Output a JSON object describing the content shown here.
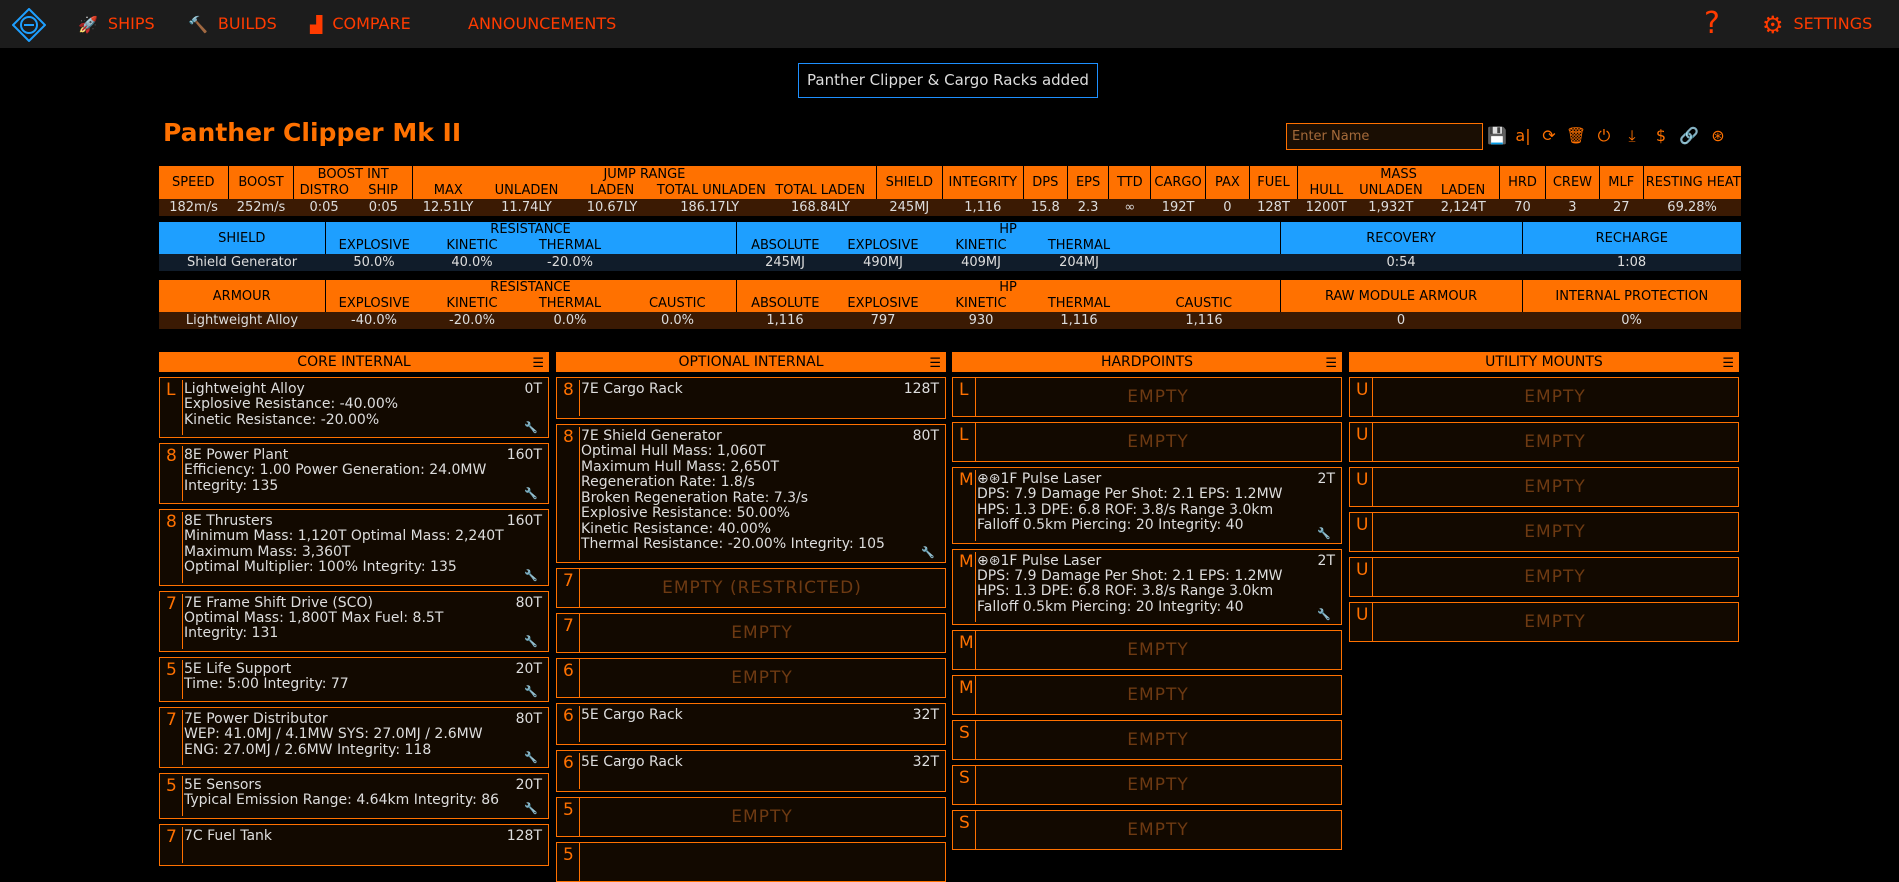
{
  "nav": {
    "ships": "SHIPS",
    "builds": "BUILDS",
    "compare": "COMPARE",
    "announcements": "ANNOUNCEMENTS",
    "help": "?",
    "settings": "SETTINGS"
  },
  "notice": "Panther Clipper & Cargo Racks added",
  "ship_title": "Panther Clipper Mk II",
  "name_placeholder": "Enter Name",
  "stats": {
    "speed": "SPEED",
    "boost": "BOOST",
    "boost_int": "BOOST INT",
    "distro": "DISTRO",
    "ship": "SHIP",
    "jump_range": "JUMP RANGE",
    "max": "MAX",
    "unladen": "UNLADEN",
    "laden": "LADEN",
    "total_unladen": "TOTAL UNLADEN",
    "total_laden": "TOTAL LADEN",
    "shield": "SHIELD",
    "integrity": "INTEGRITY",
    "dps": "DPS",
    "eps": "EPS",
    "ttd": "TTD",
    "cargo": "CARGO",
    "pax": "PAX",
    "fuel": "FUEL",
    "mass": "MASS",
    "hull": "HULL",
    "m_unladen": "UNLADEN",
    "m_laden": "LADEN",
    "hrd": "HRD",
    "crew": "CREW",
    "mlf": "MLF",
    "resting_heat": "RESTING HEAT (BETA)",
    "v_speed": "182m/s",
    "v_boost": "252m/s",
    "v_distro": "0:05",
    "v_ship": "0:05",
    "v_max": "12.51LY",
    "v_unladen": "11.74LY",
    "v_laden": "10.67LY",
    "v_total_unladen": "186.17LY",
    "v_total_laden": "168.84LY",
    "v_shield": "245MJ",
    "v_integrity": "1,116",
    "v_dps": "15.8",
    "v_eps": "2.3",
    "v_ttd": "∞",
    "v_cargo": "192T",
    "v_pax": "0",
    "v_fuel": "128T",
    "v_hull": "1200T",
    "v_m_unladen": "1,932T",
    "v_m_laden": "2,124T",
    "v_hrd": "70",
    "v_crew": "3",
    "v_mlf": "27",
    "v_heat": "69.28%"
  },
  "shield_table": {
    "shield": "SHIELD",
    "resistance": "RESISTANCE",
    "explosive": "EXPLOSIVE",
    "kinetic": "KINETIC",
    "thermal": "THERMAL",
    "hp": "HP",
    "absolute": "ABSOLUTE",
    "hp_explosive": "EXPLOSIVE",
    "hp_kinetic": "KINETIC",
    "hp_thermal": "THERMAL",
    "recovery": "RECOVERY",
    "recharge": "RECHARGE",
    "name": "Shield Generator",
    "r_exp": "50.0%",
    "r_kin": "40.0%",
    "r_therm": "-20.0%",
    "h_abs": "245MJ",
    "h_exp": "490MJ",
    "h_kin": "409MJ",
    "h_therm": "204MJ",
    "v_recovery": "0:54",
    "v_recharge": "1:08"
  },
  "armour_table": {
    "armour": "ARMOUR",
    "resistance": "RESISTANCE",
    "explosive": "EXPLOSIVE",
    "kinetic": "KINETIC",
    "thermal": "THERMAL",
    "caustic": "CAUSTIC",
    "hp": "HP",
    "absolute": "ABSOLUTE",
    "hp_explosive": "EXPLOSIVE",
    "hp_kinetic": "KINETIC",
    "hp_thermal": "THERMAL",
    "hp_caustic": "CAUSTIC",
    "raw": "RAW MODULE ARMOUR",
    "internal": "INTERNAL PROTECTION",
    "name": "Lightweight Alloy",
    "r_exp": "-40.0%",
    "r_kin": "-20.0%",
    "r_therm": "0.0%",
    "r_caus": "0.0%",
    "h_abs": "1,116",
    "h_exp": "797",
    "h_kin": "930",
    "h_therm": "1,116",
    "h_caus": "1,116",
    "v_raw": "0",
    "v_internal": "0%"
  },
  "core": {
    "header": "CORE INTERNAL",
    "slots": [
      {
        "cls": "L",
        "name": "Lightweight Alloy",
        "mass": "0T",
        "lines": [
          "Explosive Resistance: -40.00%",
          "Kinetic Resistance: -20.00%"
        ]
      },
      {
        "cls": "8",
        "name": "8E Power Plant",
        "mass": "160T",
        "lines": [
          "Efficiency: 1.00   Power Generation: 24.0MW",
          "Integrity: 135"
        ]
      },
      {
        "cls": "8",
        "name": "8E Thrusters",
        "mass": "160T",
        "lines": [
          "Minimum Mass: 1,120T   Optimal Mass: 2,240T",
          "Maximum Mass: 3,360T",
          "Optimal Multiplier: 100%   Integrity: 135"
        ]
      },
      {
        "cls": "7",
        "name": "7E Frame Shift Drive (SCO)",
        "mass": "80T",
        "lines": [
          "Optimal Mass: 1,800T   Max Fuel: 8.5T",
          "Integrity: 131"
        ]
      },
      {
        "cls": "5",
        "name": "5E Life Support",
        "mass": "20T",
        "lines": [
          "Time: 5:00   Integrity: 77"
        ]
      },
      {
        "cls": "7",
        "name": "7E Power Distributor",
        "mass": "80T",
        "lines": [
          "WEP: 41.0MJ / 4.1MW   SYS: 27.0MJ / 2.6MW",
          "ENG: 27.0MJ / 2.6MW   Integrity: 118"
        ]
      },
      {
        "cls": "5",
        "name": "5E Sensors",
        "mass": "20T",
        "lines": [
          "Typical Emission Range: 4.64km   Integrity: 86"
        ]
      },
      {
        "cls": "7",
        "name": "7C Fuel Tank",
        "mass": "128T",
        "lines": []
      }
    ]
  },
  "optional": {
    "header": "OPTIONAL INTERNAL",
    "slots": [
      {
        "cls": "8",
        "name": "7E Cargo Rack",
        "mass": "128T",
        "lines": []
      },
      {
        "cls": "8",
        "name": "7E Shield Generator",
        "mass": "80T",
        "lines": [
          "Optimal Hull Mass: 1,060T",
          "Maximum Hull Mass: 2,650T",
          "Regeneration Rate: 1.8/s",
          "Broken Regeneration Rate: 7.3/s",
          "Explosive Resistance: 50.00%",
          "Kinetic Resistance: 40.00%",
          "Thermal Resistance: -20.00%   Integrity: 105"
        ]
      },
      {
        "cls": "7",
        "empty": "EMPTY (RESTRICTED)"
      },
      {
        "cls": "7",
        "empty": "EMPTY"
      },
      {
        "cls": "6",
        "empty": "EMPTY"
      },
      {
        "cls": "6",
        "name": "5E Cargo Rack",
        "mass": "32T",
        "lines": []
      },
      {
        "cls": "6",
        "name": "5E Cargo Rack",
        "mass": "32T",
        "lines": []
      },
      {
        "cls": "5",
        "empty": "EMPTY"
      },
      {
        "cls": "5",
        "empty": ""
      }
    ]
  },
  "hardpoints": {
    "header": "HARDPOINTS",
    "slots": [
      {
        "cls": "L",
        "empty": "EMPTY"
      },
      {
        "cls": "L",
        "empty": "EMPTY"
      },
      {
        "cls": "M",
        "name": "1F Pulse Laser",
        "mass": "2T",
        "lines": [
          "DPS: 7.9   Damage Per Shot: 2.1   EPS: 1.2MW",
          "HPS: 1.3   DPE: 6.8   ROF: 3.8/s   Range 3.0km",
          "Falloff 0.5km   Piercing: 20   Integrity: 40"
        ]
      },
      {
        "cls": "M",
        "name": "1F Pulse Laser",
        "mass": "2T",
        "lines": [
          "DPS: 7.9   Damage Per Shot: 2.1   EPS: 1.2MW",
          "HPS: 1.3   DPE: 6.8   ROF: 3.8/s   Range 3.0km",
          "Falloff 0.5km   Piercing: 20   Integrity: 40"
        ]
      },
      {
        "cls": "M",
        "empty": "EMPTY"
      },
      {
        "cls": "M",
        "empty": "EMPTY"
      },
      {
        "cls": "S",
        "empty": "EMPTY"
      },
      {
        "cls": "S",
        "empty": "EMPTY"
      },
      {
        "cls": "S",
        "empty": "EMPTY"
      }
    ]
  },
  "utility": {
    "header": "UTILITY MOUNTS",
    "slots": [
      {
        "cls": "U",
        "empty": "EMPTY"
      },
      {
        "cls": "U",
        "empty": "EMPTY"
      },
      {
        "cls": "U",
        "empty": "EMPTY"
      },
      {
        "cls": "U",
        "empty": "EMPTY"
      },
      {
        "cls": "U",
        "empty": "EMPTY"
      },
      {
        "cls": "U",
        "empty": "EMPTY"
      }
    ]
  }
}
